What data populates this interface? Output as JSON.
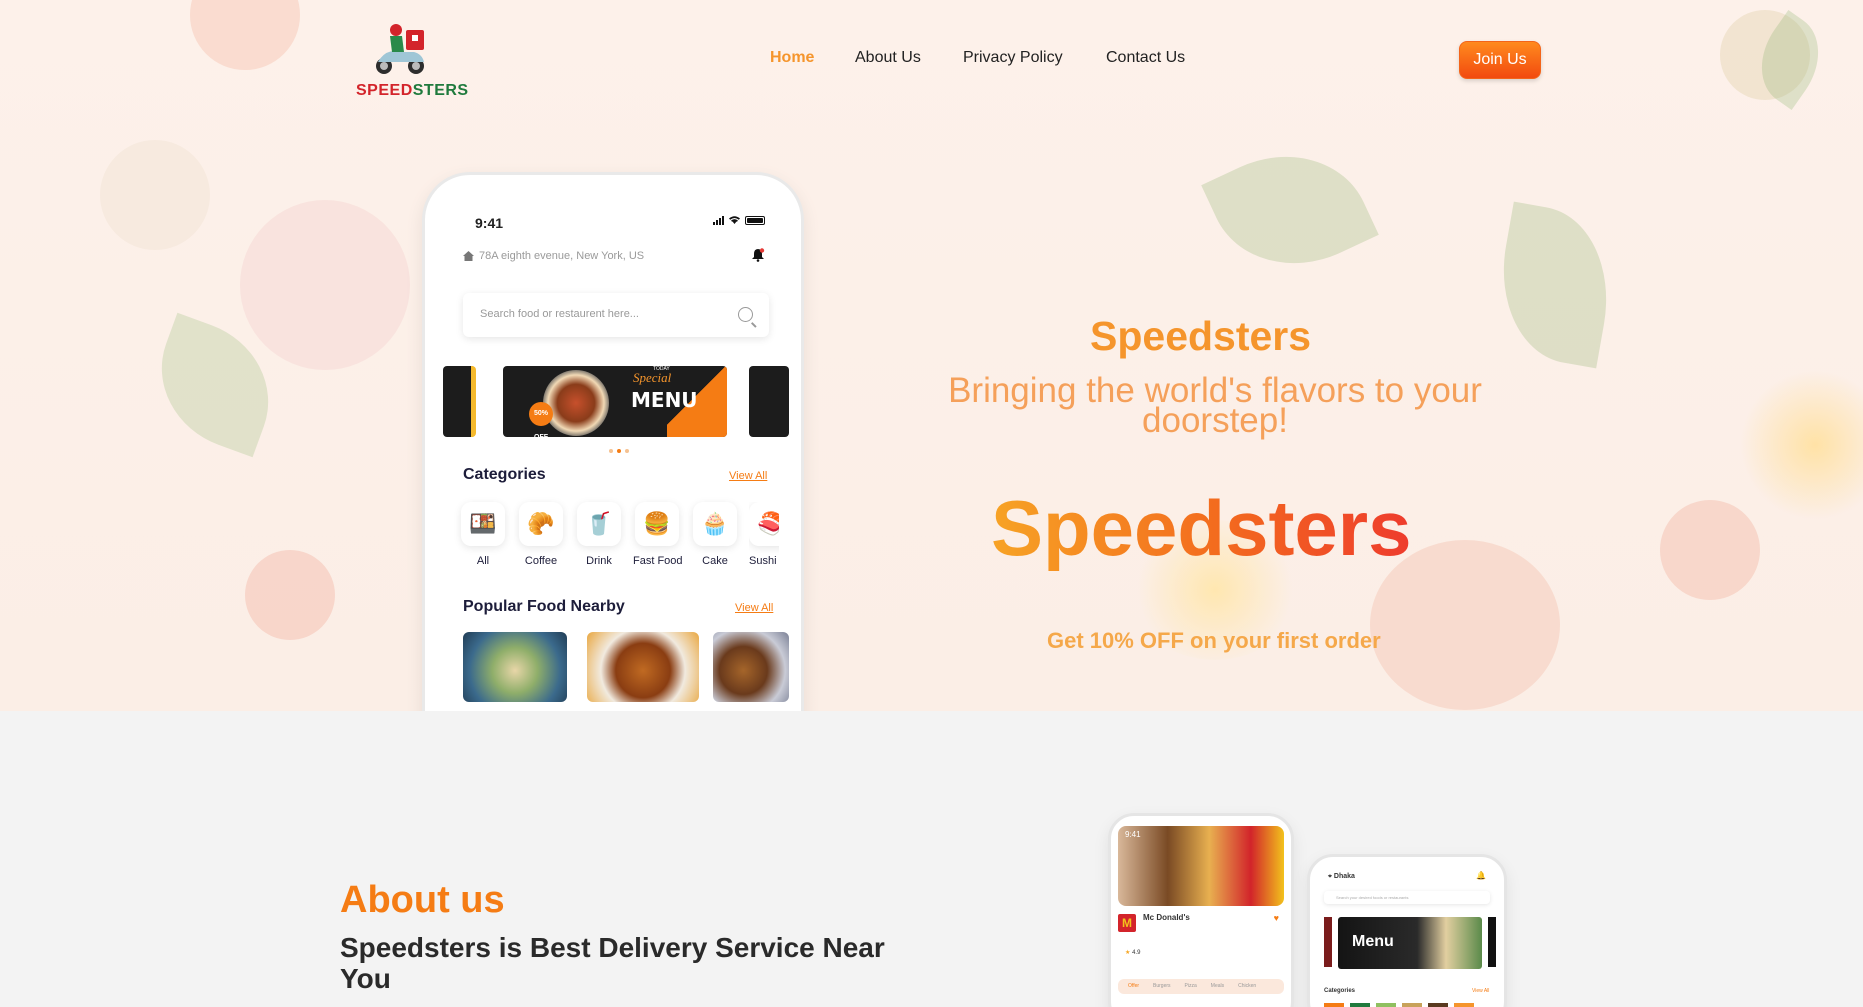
{
  "nav": {
    "logo_parts": [
      "SPEED",
      "STERS"
    ],
    "links": [
      {
        "label": "Home",
        "active": true
      },
      {
        "label": "About Us",
        "active": false
      },
      {
        "label": "Privacy Policy",
        "active": false
      },
      {
        "label": "Contact Us",
        "active": false
      }
    ],
    "join_label": "Join Us"
  },
  "colors": {
    "accent": "#f5952c",
    "orange_deep": "#f24a0f",
    "red": "#ee3b2d",
    "navy": "#1d1d3a"
  },
  "phone": {
    "time": "9:41",
    "address": "78A eighth evenue, New York, US",
    "search_placeholder": "Search food or restaurent here...",
    "banner": {
      "special": "Special",
      "menu": "MENU",
      "today": "TODAY",
      "off": "50% OFF"
    },
    "categories_title": "Categories",
    "view_all": "View All",
    "categories": [
      {
        "label": "All",
        "icon": "🍱"
      },
      {
        "label": "Coffee",
        "icon": "🥐"
      },
      {
        "label": "Drink",
        "icon": "🥤"
      },
      {
        "label": "Fast Food",
        "icon": "🍔"
      },
      {
        "label": "Cake",
        "icon": "🧁"
      },
      {
        "label": "Sushi",
        "icon": "🍣"
      }
    ],
    "popular_title": "Popular Food Nearby"
  },
  "hero": {
    "brand": "Speedsters",
    "tagline": "Bringing the world's flavors to your doorstep!",
    "big_brand": "Speedsters",
    "offer": "Get 10% OFF on your first order"
  },
  "about": {
    "label": "About us",
    "title": "Speedsters is Best Delivery Service Near You"
  },
  "mini_phone_1": {
    "time": "9:41",
    "store": "Mc Donald's",
    "rating": "4.9",
    "tabs": [
      "Offer",
      "Burgers",
      "Pizza",
      "Meals",
      "Chicken"
    ]
  },
  "mini_phone_2": {
    "location": "Dhaka",
    "search": "Search your desired foods or restaurants",
    "menu": "Menu",
    "categories": "Categories",
    "view_all": "View All"
  }
}
